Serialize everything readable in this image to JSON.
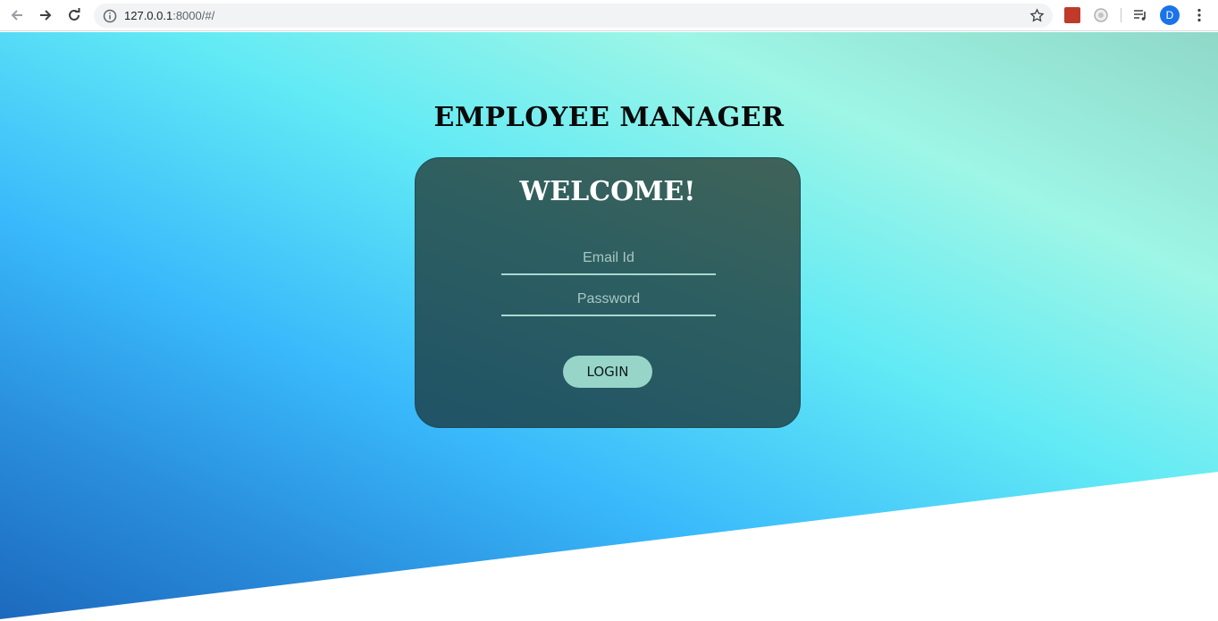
{
  "browser": {
    "url_host": "127.0.0.1",
    "url_path": ":8000/#/",
    "profile_initial": "D",
    "icons": {
      "back": "arrow-left-icon",
      "forward": "arrow-right-icon",
      "reload": "reload-icon",
      "info": "info-icon",
      "bookmark": "star-icon",
      "media": "media-control-icon",
      "menu": "kebab-menu-icon"
    }
  },
  "page": {
    "title": "EMPLOYEE MANAGER",
    "login_card": {
      "heading": "WELCOME!",
      "email_placeholder": "Email Id",
      "email_value": "",
      "password_placeholder": "Password",
      "password_value": "",
      "submit_label": "LOGIN"
    }
  },
  "colors": {
    "card_background": "#2c5e61",
    "button_background": "#98d5c9",
    "input_underline": "#a9d8cf",
    "gradient_top": "#9ef6e6",
    "gradient_bottom": "#1c69bd"
  }
}
